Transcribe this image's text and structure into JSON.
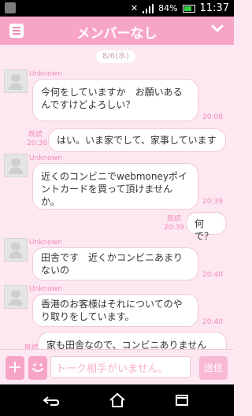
{
  "status": {
    "battery_percent": "84%",
    "time": "11:37"
  },
  "header": {
    "title": "メンバーなし"
  },
  "chat": {
    "date": "8/6(水)",
    "messages": [
      {
        "side": "left",
        "sender": "Unknown",
        "text": "今何をしていますか　お願いあるんですけどよろしい？",
        "time": "20:08"
      },
      {
        "side": "right",
        "read": "既読",
        "time": "20:38",
        "text": "はい。いま家でして、家事しています"
      },
      {
        "side": "left",
        "sender": "Unknown",
        "text": "近くのコンビニでwebmoneyポイントカードを買って頂けませんか。",
        "time": "20:39"
      },
      {
        "side": "right",
        "read": "既読",
        "time": "20:39",
        "text": "何で？"
      },
      {
        "side": "left",
        "sender": "Unknown",
        "text": "田舎です　近くかコンビニあまりないの",
        "time": "20:40"
      },
      {
        "side": "left",
        "sender": "Unknown",
        "text": "香港のお客様はそれについてのやり取りをしています。",
        "time": "20:40"
      },
      {
        "side": "right",
        "read": "既読",
        "text": "家も田舎なので、コンビニありません"
      }
    ]
  },
  "input": {
    "placeholder": "トーク相手がいません。",
    "send_label": "送信"
  },
  "colors": {
    "header": "#f7a5c7",
    "background": "#fde8f1",
    "accent": "#f28bb7"
  },
  "icons": [
    "menu-icon",
    "chevron-down-icon",
    "plus-icon",
    "smile-icon",
    "back-icon",
    "home-icon",
    "recent-apps-icon"
  ]
}
